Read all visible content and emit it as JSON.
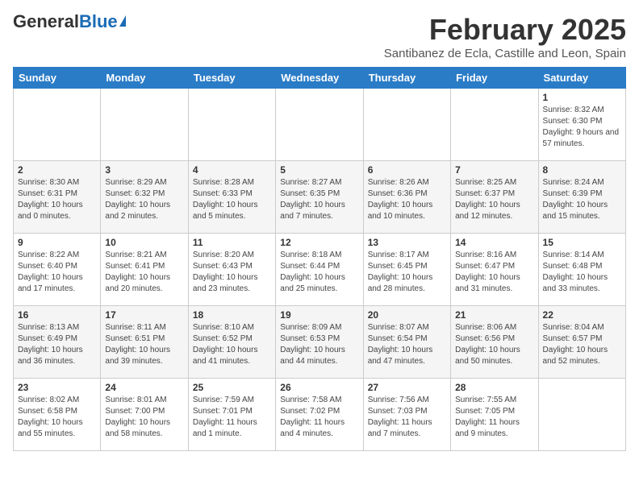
{
  "logo": {
    "general": "General",
    "blue": "Blue"
  },
  "header": {
    "month": "February 2025",
    "subtitle": "Santibanez de Ecla, Castille and Leon, Spain"
  },
  "weekdays": [
    "Sunday",
    "Monday",
    "Tuesday",
    "Wednesday",
    "Thursday",
    "Friday",
    "Saturday"
  ],
  "weeks": [
    [
      {
        "day": "",
        "info": ""
      },
      {
        "day": "",
        "info": ""
      },
      {
        "day": "",
        "info": ""
      },
      {
        "day": "",
        "info": ""
      },
      {
        "day": "",
        "info": ""
      },
      {
        "day": "",
        "info": ""
      },
      {
        "day": "1",
        "info": "Sunrise: 8:32 AM\nSunset: 6:30 PM\nDaylight: 9 hours and 57 minutes."
      }
    ],
    [
      {
        "day": "2",
        "info": "Sunrise: 8:30 AM\nSunset: 6:31 PM\nDaylight: 10 hours and 0 minutes."
      },
      {
        "day": "3",
        "info": "Sunrise: 8:29 AM\nSunset: 6:32 PM\nDaylight: 10 hours and 2 minutes."
      },
      {
        "day": "4",
        "info": "Sunrise: 8:28 AM\nSunset: 6:33 PM\nDaylight: 10 hours and 5 minutes."
      },
      {
        "day": "5",
        "info": "Sunrise: 8:27 AM\nSunset: 6:35 PM\nDaylight: 10 hours and 7 minutes."
      },
      {
        "day": "6",
        "info": "Sunrise: 8:26 AM\nSunset: 6:36 PM\nDaylight: 10 hours and 10 minutes."
      },
      {
        "day": "7",
        "info": "Sunrise: 8:25 AM\nSunset: 6:37 PM\nDaylight: 10 hours and 12 minutes."
      },
      {
        "day": "8",
        "info": "Sunrise: 8:24 AM\nSunset: 6:39 PM\nDaylight: 10 hours and 15 minutes."
      }
    ],
    [
      {
        "day": "9",
        "info": "Sunrise: 8:22 AM\nSunset: 6:40 PM\nDaylight: 10 hours and 17 minutes."
      },
      {
        "day": "10",
        "info": "Sunrise: 8:21 AM\nSunset: 6:41 PM\nDaylight: 10 hours and 20 minutes."
      },
      {
        "day": "11",
        "info": "Sunrise: 8:20 AM\nSunset: 6:43 PM\nDaylight: 10 hours and 23 minutes."
      },
      {
        "day": "12",
        "info": "Sunrise: 8:18 AM\nSunset: 6:44 PM\nDaylight: 10 hours and 25 minutes."
      },
      {
        "day": "13",
        "info": "Sunrise: 8:17 AM\nSunset: 6:45 PM\nDaylight: 10 hours and 28 minutes."
      },
      {
        "day": "14",
        "info": "Sunrise: 8:16 AM\nSunset: 6:47 PM\nDaylight: 10 hours and 31 minutes."
      },
      {
        "day": "15",
        "info": "Sunrise: 8:14 AM\nSunset: 6:48 PM\nDaylight: 10 hours and 33 minutes."
      }
    ],
    [
      {
        "day": "16",
        "info": "Sunrise: 8:13 AM\nSunset: 6:49 PM\nDaylight: 10 hours and 36 minutes."
      },
      {
        "day": "17",
        "info": "Sunrise: 8:11 AM\nSunset: 6:51 PM\nDaylight: 10 hours and 39 minutes."
      },
      {
        "day": "18",
        "info": "Sunrise: 8:10 AM\nSunset: 6:52 PM\nDaylight: 10 hours and 41 minutes."
      },
      {
        "day": "19",
        "info": "Sunrise: 8:09 AM\nSunset: 6:53 PM\nDaylight: 10 hours and 44 minutes."
      },
      {
        "day": "20",
        "info": "Sunrise: 8:07 AM\nSunset: 6:54 PM\nDaylight: 10 hours and 47 minutes."
      },
      {
        "day": "21",
        "info": "Sunrise: 8:06 AM\nSunset: 6:56 PM\nDaylight: 10 hours and 50 minutes."
      },
      {
        "day": "22",
        "info": "Sunrise: 8:04 AM\nSunset: 6:57 PM\nDaylight: 10 hours and 52 minutes."
      }
    ],
    [
      {
        "day": "23",
        "info": "Sunrise: 8:02 AM\nSunset: 6:58 PM\nDaylight: 10 hours and 55 minutes."
      },
      {
        "day": "24",
        "info": "Sunrise: 8:01 AM\nSunset: 7:00 PM\nDaylight: 10 hours and 58 minutes."
      },
      {
        "day": "25",
        "info": "Sunrise: 7:59 AM\nSunset: 7:01 PM\nDaylight: 11 hours and 1 minute."
      },
      {
        "day": "26",
        "info": "Sunrise: 7:58 AM\nSunset: 7:02 PM\nDaylight: 11 hours and 4 minutes."
      },
      {
        "day": "27",
        "info": "Sunrise: 7:56 AM\nSunset: 7:03 PM\nDaylight: 11 hours and 7 minutes."
      },
      {
        "day": "28",
        "info": "Sunrise: 7:55 AM\nSunset: 7:05 PM\nDaylight: 11 hours and 9 minutes."
      },
      {
        "day": "",
        "info": ""
      }
    ]
  ]
}
